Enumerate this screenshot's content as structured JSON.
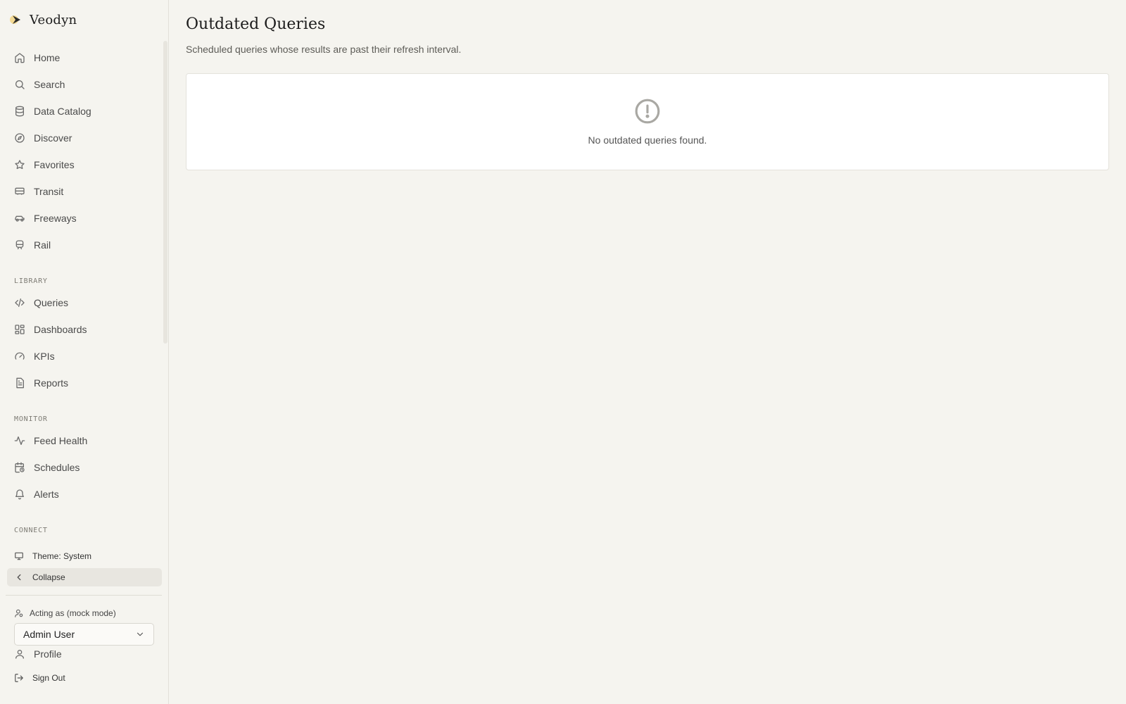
{
  "app": {
    "name": "Veodyn"
  },
  "sidebar": {
    "primary_items": [
      {
        "label": "Home",
        "icon": "home-icon"
      },
      {
        "label": "Search",
        "icon": "search-icon"
      },
      {
        "label": "Data Catalog",
        "icon": "database-icon"
      },
      {
        "label": "Discover",
        "icon": "compass-icon"
      },
      {
        "label": "Favorites",
        "icon": "star-icon"
      },
      {
        "label": "Transit",
        "icon": "bus-icon"
      },
      {
        "label": "Freeways",
        "icon": "car-icon"
      },
      {
        "label": "Rail",
        "icon": "train-icon"
      }
    ],
    "library_label": "LIBRARY",
    "library_items": [
      {
        "label": "Queries",
        "icon": "code-icon"
      },
      {
        "label": "Dashboards",
        "icon": "dashboard-icon"
      },
      {
        "label": "KPIs",
        "icon": "gauge-icon"
      },
      {
        "label": "Reports",
        "icon": "file-text-icon"
      }
    ],
    "monitor_label": "MONITOR",
    "monitor_items": [
      {
        "label": "Feed Health",
        "icon": "activity-icon"
      },
      {
        "label": "Schedules",
        "icon": "calendar-clock-icon"
      },
      {
        "label": "Alerts",
        "icon": "bell-icon"
      }
    ],
    "connect_label": "CONNECT",
    "theme_label": "Theme: System",
    "collapse_label": "Collapse",
    "acting_as_label": "Acting as (mock mode)",
    "selected_user": "Admin User",
    "profile_label": "Profile",
    "signout_label": "Sign Out"
  },
  "main": {
    "title": "Outdated Queries",
    "subtitle": "Scheduled queries whose results are past their refresh interval.",
    "empty_message": "No outdated queries found."
  }
}
